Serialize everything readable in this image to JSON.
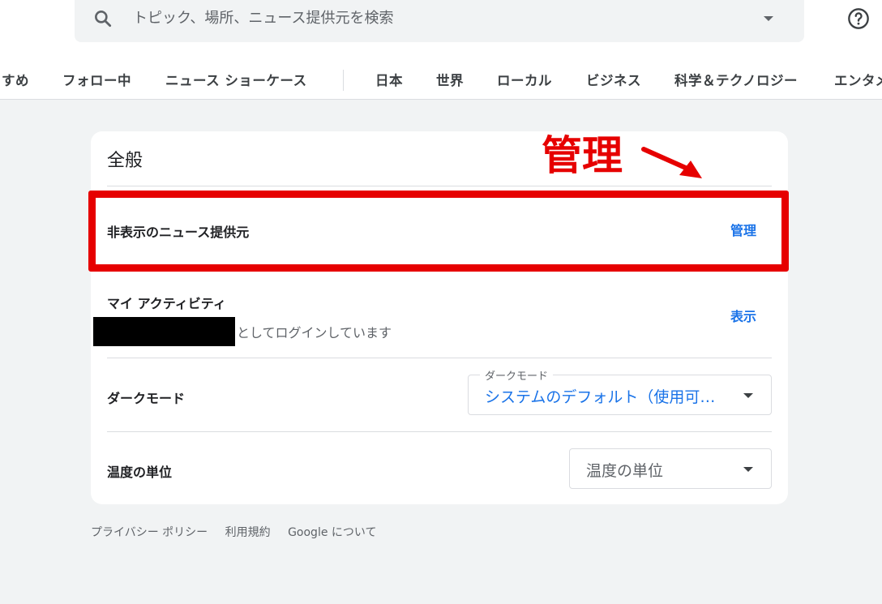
{
  "search": {
    "placeholder": "トピック、場所、ニュース提供元を検索",
    "icon": "search-icon"
  },
  "header": {
    "help_icon": "help-icon"
  },
  "nav": {
    "items": [
      "すめ",
      "フォロー中",
      "ニュース ショーケース",
      "日本",
      "世界",
      "ローカル",
      "ビジネス",
      "科学＆テクノロジー",
      "エンタメ"
    ]
  },
  "settings": {
    "title": "全般",
    "hidden_sources": {
      "label": "非表示のニュース提供元",
      "action": "管理"
    },
    "my_activity": {
      "label": "マイ アクティビティ",
      "login_text": "としてログインしています",
      "action": "表示"
    },
    "dark_mode": {
      "label": "ダークモード",
      "field_label": "ダークモード",
      "value": "システムのデフォルト（使用可…"
    },
    "temperature": {
      "label": "温度の単位",
      "value": "温度の単位"
    }
  },
  "annotation": {
    "text": "管理",
    "color": "#e60000"
  },
  "footer": {
    "links": [
      "プライバシー ポリシー",
      "利用規約",
      "Google について"
    ]
  },
  "colors": {
    "accent": "#1a73e8",
    "background": "#f1f3f4"
  }
}
